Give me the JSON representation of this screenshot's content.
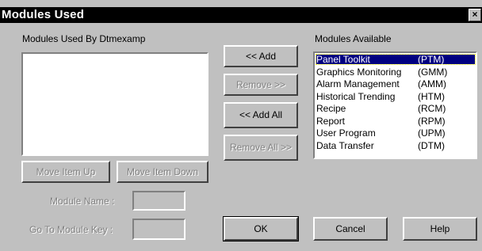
{
  "window": {
    "title": "Modules Used",
    "close_glyph": "×"
  },
  "used": {
    "label": "Modules Used By Dtmexamp",
    "items": []
  },
  "available": {
    "label": "Modules Available",
    "items": [
      {
        "name": "Panel Toolkit",
        "code": "(PTM)",
        "selected": true
      },
      {
        "name": "Graphics Monitoring",
        "code": "(GMM)"
      },
      {
        "name": "Alarm Management",
        "code": "(AMM)"
      },
      {
        "name": "Historical Trending",
        "code": "(HTM)"
      },
      {
        "name": "Recipe",
        "code": "(RCM)"
      },
      {
        "name": "Report",
        "code": "(RPM)"
      },
      {
        "name": "User Program",
        "code": "(UPM)"
      },
      {
        "name": "Data Transfer",
        "code": "(DTM)"
      }
    ]
  },
  "buttons": {
    "add": "<< Add",
    "remove": "Remove >>",
    "add_all": "<< Add All",
    "remove_all": "Remove All >>",
    "move_up": "Move Item Up",
    "move_down": "Move Item Down",
    "ok": "OK",
    "cancel": "Cancel",
    "help": "Help"
  },
  "fields": {
    "module_name_label": "Module Name :",
    "module_name_value": "",
    "goto_key_label": "Go To Module Key :",
    "goto_key_value": ""
  }
}
